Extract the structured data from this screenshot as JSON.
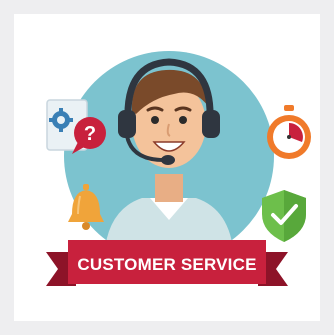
{
  "banner": {
    "label": "CUSTOMER SERVICE"
  },
  "icons": [
    "gear-icon",
    "question-bubble-icon",
    "bell-icon",
    "stopwatch-icon",
    "shield-check-icon",
    "headset-icon"
  ],
  "colors": {
    "background": "#eeeef0",
    "card": "#ffffff",
    "circle": "#7cc3cf",
    "banner": "#c8213d",
    "banner_dark": "#8d1328",
    "skin": "#f4c39b",
    "hair": "#7a4a2a",
    "shirt": "#cfe3e6",
    "headset": "#2f3640",
    "bell": "#f0a43a",
    "stopwatch": "#f07a2a",
    "shield": "#6dbf4b"
  }
}
